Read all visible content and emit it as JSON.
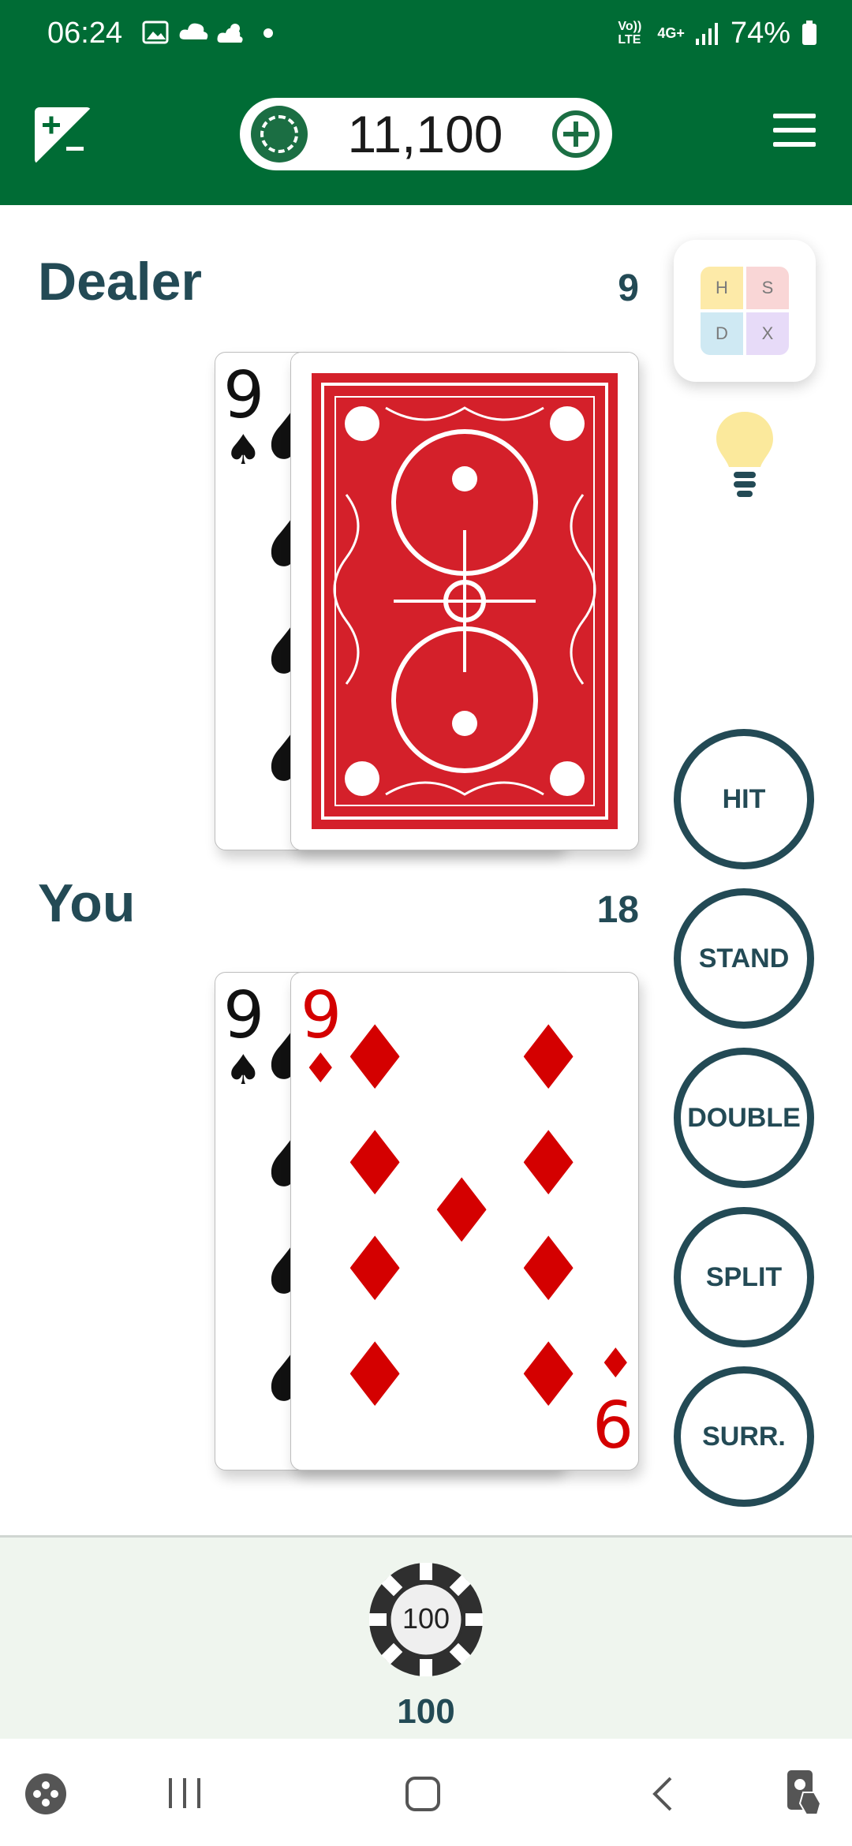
{
  "status_bar": {
    "time": "06:24",
    "signal_text": "Vo)) LTE",
    "network_text": "4G+",
    "battery": "74%",
    "icons": [
      "image-icon",
      "cloud-icon",
      "weather-icon",
      "dot-icon",
      "signal-icon",
      "battery-icon"
    ]
  },
  "app_bar": {
    "balance": "11,100",
    "icons": [
      "stats-icon",
      "chip-icon",
      "add-coins-icon",
      "menu-icon"
    ]
  },
  "dealer": {
    "label": "Dealer",
    "total": "9",
    "cards": [
      {
        "rank": "9",
        "suit": "♠",
        "face": "up"
      },
      {
        "face": "down"
      }
    ]
  },
  "player": {
    "label": "You",
    "total": "18",
    "cards": [
      {
        "rank": "9",
        "suit": "♠",
        "face": "up"
      },
      {
        "rank": "9",
        "suit": "♦",
        "face": "up",
        "bottom_rank": "6"
      }
    ]
  },
  "strategy": {
    "cells": [
      "H",
      "S",
      "D",
      "X"
    ],
    "colors": [
      "#fdeaa8",
      "#f9d6d6",
      "#cfe9f3",
      "#e7dbf8"
    ]
  },
  "actions": {
    "hit": "HIT",
    "stand": "STAND",
    "double": "DOUBLE",
    "split": "SPLIT",
    "surrender": "SURR."
  },
  "bet": {
    "chip_value": "100",
    "amount": "100"
  },
  "colors": {
    "brand_green": "#006c35",
    "text_teal": "#234a55",
    "card_red": "#d40000",
    "tray_bg": "#eff5ee"
  }
}
